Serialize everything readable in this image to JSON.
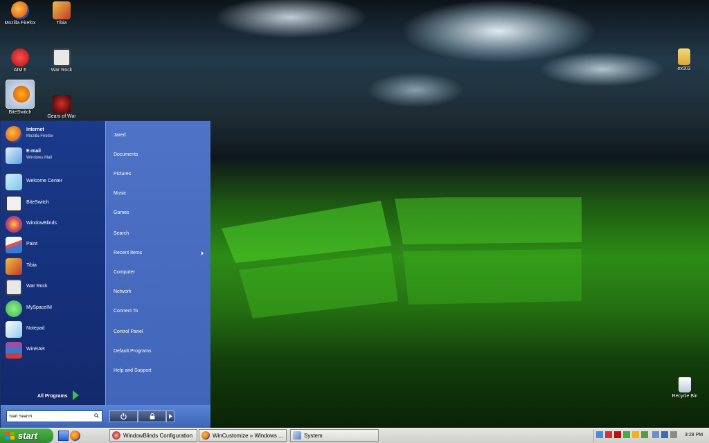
{
  "desktop": {
    "icons": [
      {
        "label": "Mozilla Firefox",
        "icon": "firefox-icon",
        "color": "#e86b1a"
      },
      {
        "label": "Tibia",
        "icon": "tibia-icon",
        "color": "#c0392b"
      },
      {
        "label": "AIM 6",
        "icon": "aim-icon",
        "color": "#d91f1f"
      },
      {
        "label": "War Rock",
        "icon": "war-rock-icon",
        "color": "#8a8a8a"
      },
      {
        "label": "BiteSwitch",
        "icon": "biteswitch-icon",
        "color": "#f0a020"
      },
      {
        "label": "Gears of War",
        "icon": "gears-of-war-icon",
        "color": "#7a1010"
      },
      {
        "label": "ex003",
        "icon": "folder-icon",
        "color": "#e8c35a"
      },
      {
        "label": "Recycle Bin",
        "icon": "recycle-bin-icon",
        "color": "#dde6ee"
      }
    ]
  },
  "start_menu": {
    "pinned": [
      {
        "label": "Internet",
        "sub": "Mozilla Firefox",
        "icon": "firefox-icon",
        "color": "#e86b1a"
      },
      {
        "label": "E-mail",
        "sub": "Windows Mail",
        "icon": "mail-icon",
        "color": "#5aa0e0"
      }
    ],
    "programs": [
      {
        "label": "Welcome Center",
        "icon": "welcome-center-icon",
        "color": "#7cc4e8"
      },
      {
        "label": "BiteSwitch",
        "icon": "biteswitch-icon",
        "color": "#e0e0e0"
      },
      {
        "label": "WindowBlinds",
        "icon": "windowblinds-icon",
        "color": "#d04060"
      },
      {
        "label": "Paint",
        "icon": "paint-icon",
        "color": "#e05050"
      },
      {
        "label": "Tibia",
        "icon": "tibia-icon",
        "color": "#c0392b"
      },
      {
        "label": "War Rock",
        "icon": "war-rock-icon",
        "color": "#9a9a9a"
      },
      {
        "label": "MySpaceIM",
        "icon": "myspaceim-icon",
        "color": "#3cb043"
      },
      {
        "label": "Notepad",
        "icon": "notepad-icon",
        "color": "#8fc8f0"
      },
      {
        "label": "WinRAR",
        "icon": "winrar-icon",
        "color": "#9b4fa0"
      }
    ],
    "all_programs": "All Programs",
    "places": [
      "Jared",
      "Documents",
      "Pictures",
      "Music",
      "Games",
      "Search",
      "Recent Items",
      "Computer",
      "Network",
      "Connect To",
      "Control Panel",
      "Default Programs",
      "Help and Support"
    ],
    "search_value": "Start Search"
  },
  "taskbar": {
    "start_label": "start",
    "quicklaunch": [
      "show-desktop-icon",
      "firefox-icon"
    ],
    "buttons": [
      {
        "label": "WindowBlinds Configuration",
        "icon": "windowblinds-icon",
        "color": "#d04060"
      },
      {
        "label": "WinCustomize » Windows ...",
        "icon": "firefox-icon",
        "color": "#e86b1a"
      },
      {
        "label": "System",
        "icon": "system-icon",
        "color": "#5c7cc8"
      }
    ],
    "clock": "3:28 PM"
  }
}
